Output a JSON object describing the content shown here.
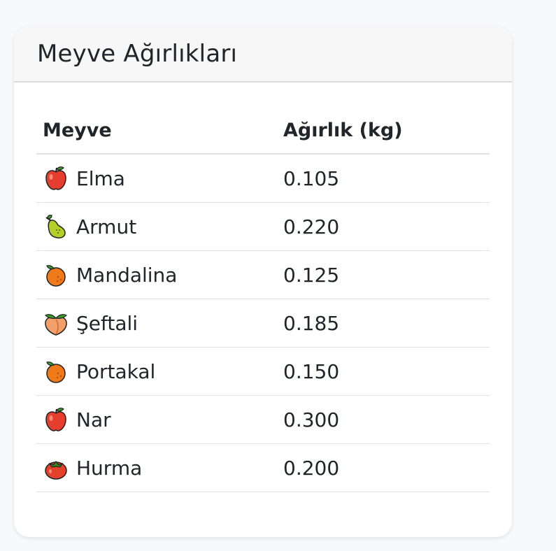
{
  "card": {
    "title": "Meyve Ağırlıkları"
  },
  "table": {
    "columns": [
      "Meyve",
      "Ağırlık (kg)"
    ],
    "rows": [
      {
        "name": "Elma",
        "weight": "0.105",
        "icon": "apple-icon",
        "color": "#e53e2e"
      },
      {
        "name": "Armut",
        "weight": "0.220",
        "icon": "pear-icon",
        "color": "#b5cf2a"
      },
      {
        "name": "Mandalina",
        "weight": "0.125",
        "icon": "tangerine-icon",
        "color": "#f07a1a"
      },
      {
        "name": "Şeftali",
        "weight": "0.185",
        "icon": "peach-icon",
        "color": "#f4a06a"
      },
      {
        "name": "Portakal",
        "weight": "0.150",
        "icon": "orange-icon",
        "color": "#f07a1a"
      },
      {
        "name": "Nar",
        "weight": "0.300",
        "icon": "pomegranate-icon",
        "color": "#e53e2e"
      },
      {
        "name": "Hurma",
        "weight": "0.200",
        "icon": "persimmon-icon",
        "color": "#e2412a"
      }
    ]
  }
}
